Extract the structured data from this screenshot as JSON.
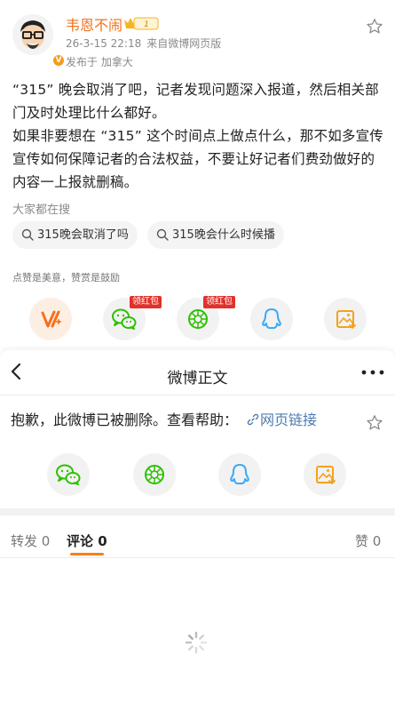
{
  "post": {
    "username": "韦恩不闹",
    "level_badge": "1",
    "date": "26-3-15 22:18",
    "source": "来自微博网页版",
    "location": "发布于 加拿大",
    "body_line_1": "“315” 晚会取消了吧，记者发现问题深入报道，然后相关部门及时处理比什么都好。",
    "body_line_2": "如果非要想在 “315” 这个时间点上做点什么，那不如多宣传宣传如何保障记者的合法权益，不要让好记者们费劲做好的内容一上报就删稿。",
    "search_heading": "大家都在搜",
    "search_chips": [
      "315晚会取消了吗",
      "315晚会什么时候播"
    ],
    "praise_tip": "点赞是美意，赞赏是鼓励",
    "red_packet_tag": "领红包",
    "share_icons": [
      "reward-icon",
      "wechat-icon",
      "moments-icon",
      "qq-icon",
      "save-image-icon"
    ]
  },
  "sheet": {
    "title": "微博正文",
    "deleted_notice": "抱歉，此微博已被删除。查看帮助：",
    "link_label": "网页链接",
    "share_icons": [
      "wechat-icon",
      "moments-icon",
      "qq-icon",
      "save-image-icon"
    ],
    "tabs": {
      "repost_label": "转发",
      "repost_count": "0",
      "comment_label": "评论",
      "comment_count": "0",
      "like_label": "赞",
      "like_count": "0"
    }
  },
  "colors": {
    "brand_orange": "#f4701b",
    "link_blue": "#4f7cae",
    "wechat_green": "#2dc100",
    "qq_blue": "#3fa9f5",
    "red_tag": "#e2312a"
  }
}
